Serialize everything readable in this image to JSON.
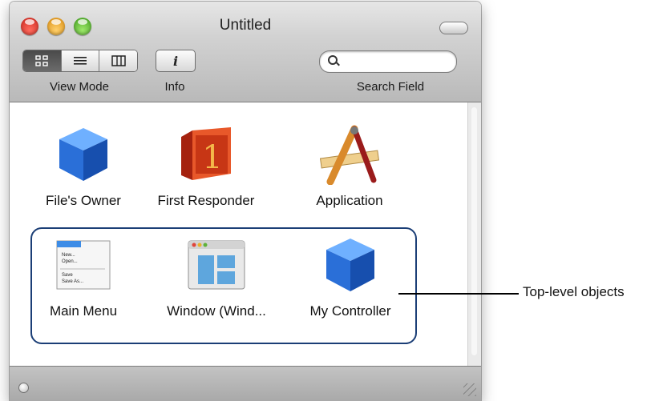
{
  "window": {
    "title": "Untitled"
  },
  "toolbar": {
    "view_mode_label": "View Mode",
    "info_label": "Info",
    "info_glyph": "i",
    "search_label": "Search Field",
    "search_value": "",
    "search_placeholder": ""
  },
  "objects": [
    {
      "label": "File's Owner",
      "icon": "cube-icon"
    },
    {
      "label": "First Responder",
      "icon": "first-responder-icon"
    },
    {
      "label": "Application",
      "icon": "application-icon"
    },
    {
      "label": "Main Menu",
      "icon": "main-menu-icon"
    },
    {
      "label": "Window (Wind...",
      "icon": "window-icon"
    },
    {
      "label": "My Controller",
      "icon": "cube-icon"
    }
  ],
  "main_menu_icon_items": [
    "New...",
    "Open...",
    "Save",
    "Save As..."
  ],
  "first_responder_glyph": "1",
  "callout": {
    "text": "Top-level objects"
  },
  "colors": {
    "group_box_border": "#1b3e76",
    "cube_blue": "#1f63d6",
    "first_responder_red": "#d9371a"
  }
}
